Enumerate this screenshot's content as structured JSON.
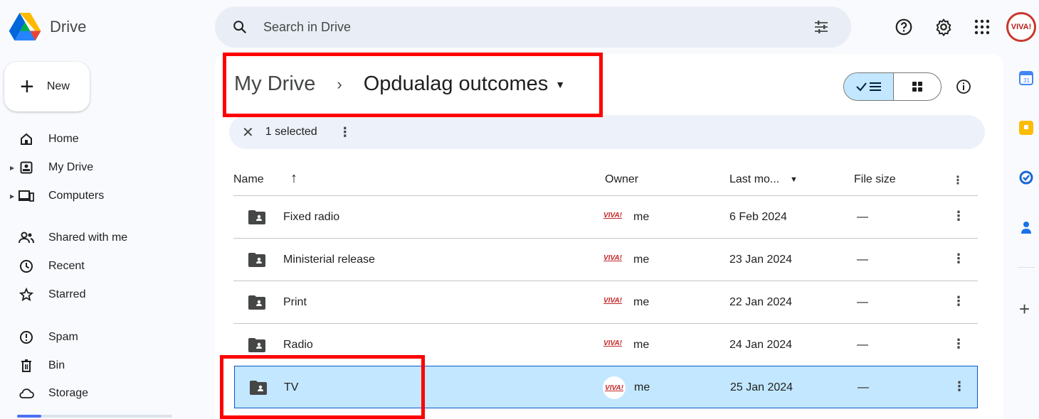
{
  "app": {
    "title": "Drive"
  },
  "search": {
    "placeholder": "Search in Drive"
  },
  "sidebar": {
    "new_label": "New",
    "items": [
      {
        "label": "Home",
        "icon": "home-icon"
      },
      {
        "label": "My Drive",
        "icon": "my-drive-icon"
      },
      {
        "label": "Computers",
        "icon": "computers-icon"
      },
      {
        "label": "Shared with me",
        "icon": "shared-icon"
      },
      {
        "label": "Recent",
        "icon": "clock-icon"
      },
      {
        "label": "Starred",
        "icon": "star-icon"
      },
      {
        "label": "Spam",
        "icon": "spam-icon"
      },
      {
        "label": "Bin",
        "icon": "trash-icon"
      },
      {
        "label": "Storage",
        "icon": "cloud-icon"
      }
    ]
  },
  "breadcrumb": {
    "root": "My Drive",
    "current": "Opdualag outcomes"
  },
  "selection": {
    "text": "1 selected"
  },
  "table": {
    "headers": {
      "name": "Name",
      "owner": "Owner",
      "modified": "Last mo...",
      "size": "File size"
    },
    "rows": [
      {
        "name": "Fixed radio",
        "owner": "me",
        "modified": "6 Feb 2024",
        "size": "—"
      },
      {
        "name": "Ministerial release",
        "owner": "me",
        "modified": "23 Jan 2024",
        "size": "—"
      },
      {
        "name": "Print",
        "owner": "me",
        "modified": "22 Jan 2024",
        "size": "—"
      },
      {
        "name": "Radio",
        "owner": "me",
        "modified": "24 Jan 2024",
        "size": "—"
      },
      {
        "name": "TV",
        "owner": "me",
        "modified": "25 Jan 2024",
        "size": "—"
      }
    ]
  },
  "owner_logo_text": "VIVA!",
  "colors": {
    "accent": "#0b57d0",
    "selected_row": "#c2e7ff",
    "highlight": "#ff0000"
  }
}
